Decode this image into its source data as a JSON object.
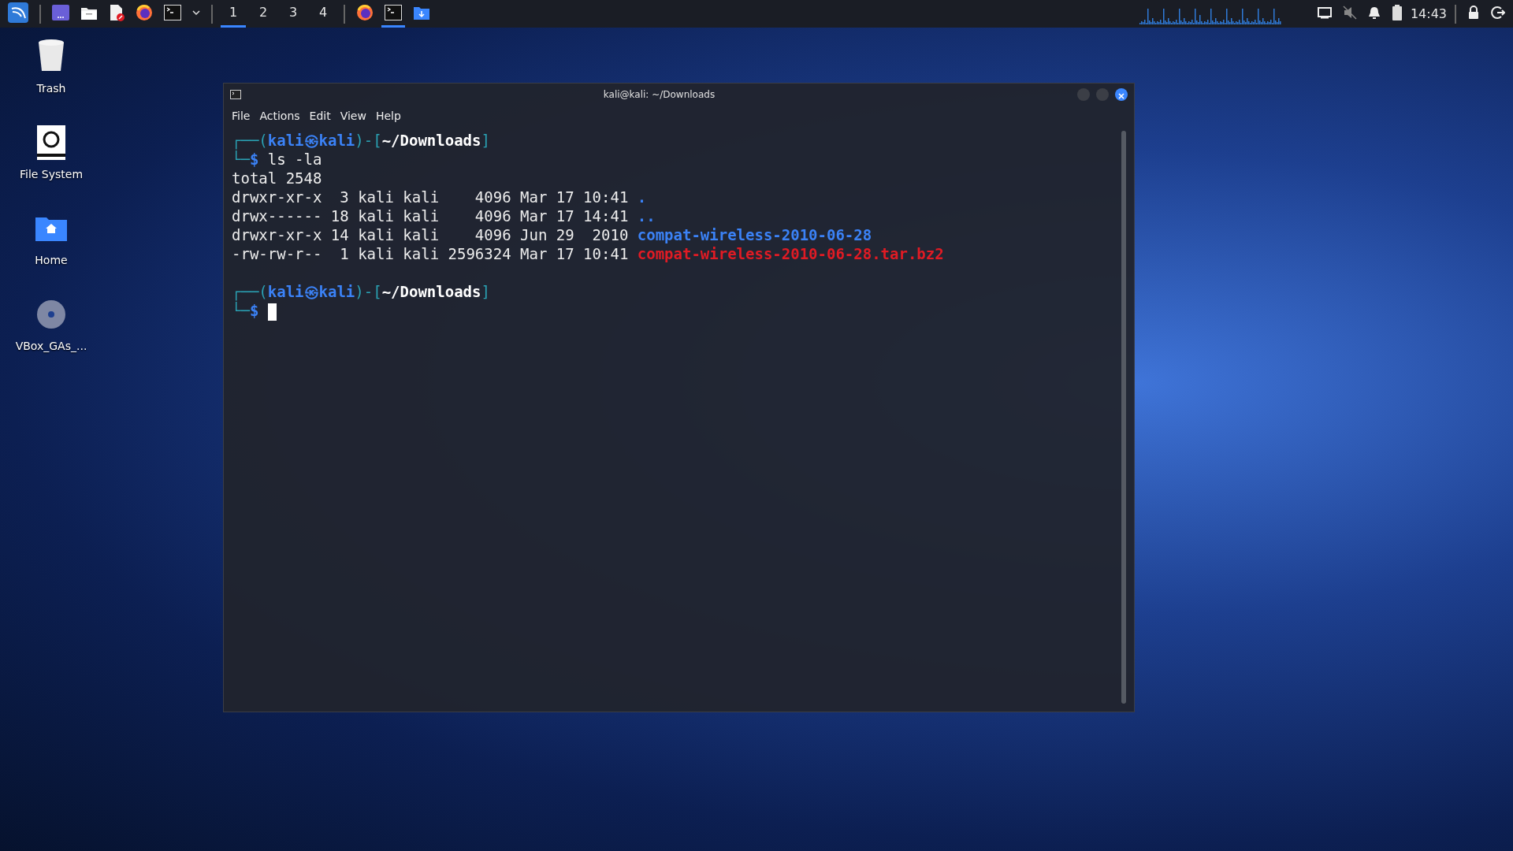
{
  "taskbar": {
    "launchers": [
      {
        "kind": "desktop"
      },
      {
        "kind": "files"
      },
      {
        "kind": "editor"
      },
      {
        "kind": "firefox"
      },
      {
        "kind": "terminal"
      }
    ],
    "workspaces": [
      {
        "label": "1",
        "selected": true
      },
      {
        "label": "2",
        "selected": false
      },
      {
        "label": "3",
        "selected": false
      },
      {
        "label": "4",
        "selected": false
      }
    ],
    "tasks": [
      {
        "kind": "firefox",
        "selected": false
      },
      {
        "kind": "terminal",
        "selected": true
      },
      {
        "kind": "downloads",
        "selected": false
      }
    ],
    "clock": "14:43"
  },
  "desktop_icons": [
    {
      "kind": "trash",
      "label": "Trash"
    },
    {
      "kind": "drive",
      "label": "File System"
    },
    {
      "kind": "home",
      "label": "Home"
    },
    {
      "kind": "disc",
      "label": "VBox_GAs_..."
    }
  ],
  "window": {
    "title": "kali@kali: ~/Downloads",
    "menu": [
      "File",
      "Actions",
      "Edit",
      "View",
      "Help"
    ],
    "lines": [
      {
        "kind": "prompt",
        "open": "┌──(",
        "user": "kali",
        "symbol": "㉿",
        "host": "kali",
        "mid": ")-[",
        "path": "~/Downloads",
        "close": "]"
      },
      {
        "kind": "command",
        "prefix": "└─",
        "sign": "$",
        "text": "ls -la"
      },
      {
        "kind": "plain",
        "text": "total 2548"
      },
      {
        "kind": "entry",
        "listing": "drwxr-xr-x  3 kali kali    4096 Mar 17 10:41 ",
        "name": ".",
        "color": "#3b82f6"
      },
      {
        "kind": "entry",
        "listing": "drwx------ 18 kali kali    4096 Mar 17 14:41 ",
        "name": "..",
        "color": "#3b82f6"
      },
      {
        "kind": "entry",
        "listing": "drwxr-xr-x 14 kali kali    4096 Jun 29  2010 ",
        "name": "compat-wireless-2010-06-28",
        "color": "#3b82f6"
      },
      {
        "kind": "entry",
        "listing": "-rw-rw-r--  1 kali kali 2596324 Mar 17 10:41 ",
        "name": "compat-wireless-2010-06-28.tar.bz2",
        "color": "#e01b24"
      },
      {
        "kind": "blank"
      },
      {
        "kind": "prompt",
        "open": "┌──(",
        "user": "kali",
        "symbol": "㉿",
        "host": "kali",
        "mid": ")-[",
        "path": "~/Downloads",
        "close": "]"
      },
      {
        "kind": "command",
        "prefix": "└─",
        "sign": "$",
        "cursor": true
      }
    ]
  }
}
